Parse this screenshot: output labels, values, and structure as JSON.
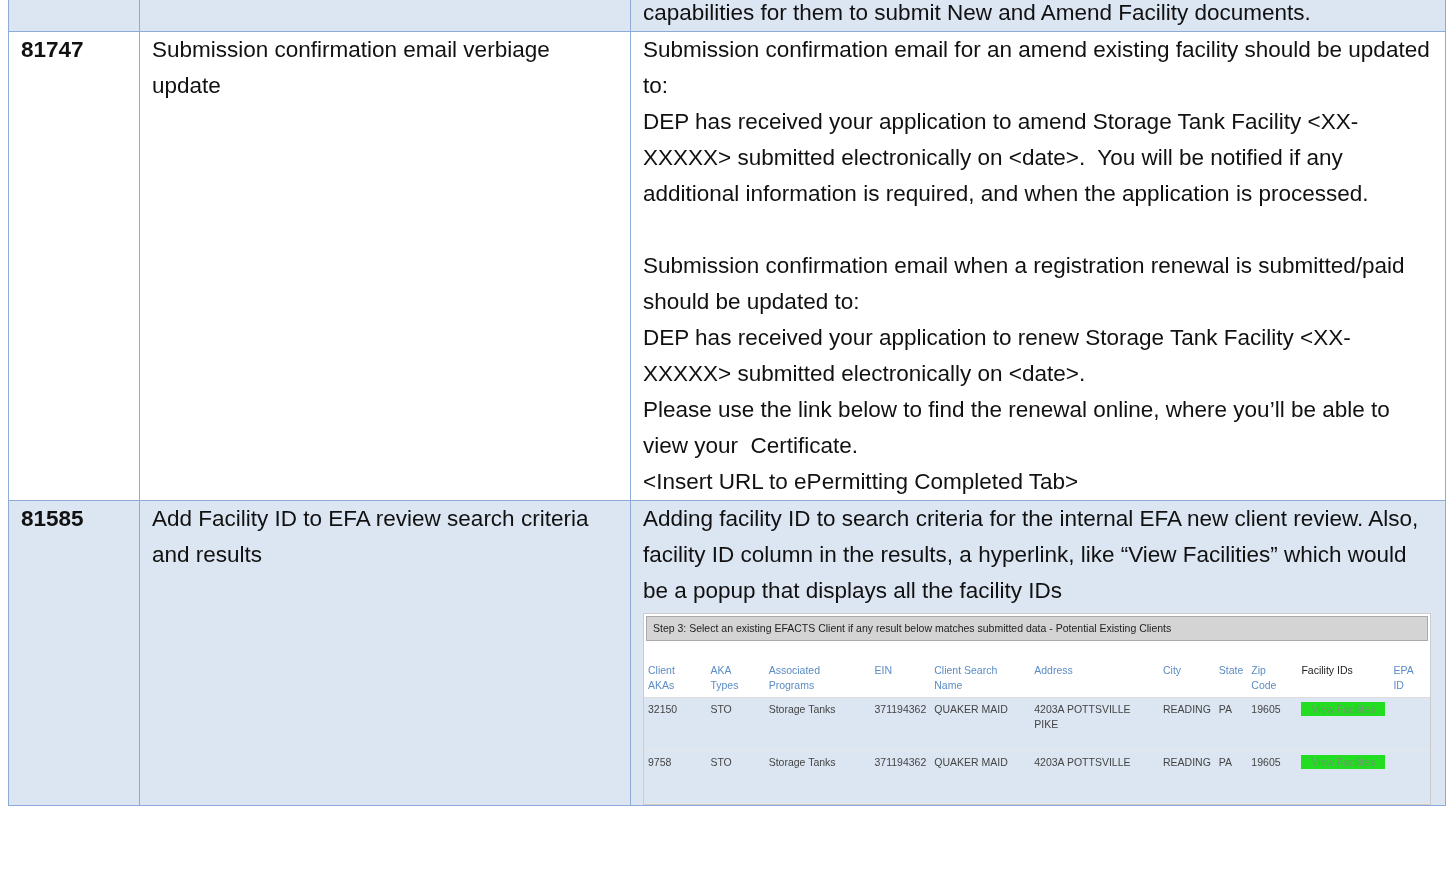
{
  "table": {
    "rows": [
      {
        "shaded": true,
        "details": [
          [
            "capabilities for them to submit New and Amend Facility documents."
          ]
        ]
      },
      {
        "shaded": false,
        "id": "81747",
        "title": "Submission confirmation email verbiage update",
        "details": [
          [
            "Submission confirmation email for an amend existing facility should be updated to:",
            "DEP has received your application to amend Storage Tank Facility <XX-XXXXX> submitted electronically on <date>.  You will be notified if any additional information is required, and when the application is processed."
          ],
          [
            "Submission confirmation email when a registration renewal is submitted/paid should be updated to:",
            "DEP has received your application to renew Storage Tank Facility <XX-XXXXX> submitted electronically on <date>.",
            "Please use the link below to find the renewal online, where you’ll be able to view your  Certificate.",
            "<Insert URL to ePermitting Completed Tab>"
          ]
        ]
      },
      {
        "shaded": true,
        "id": "81585",
        "title": "Add Facility ID to EFA review search criteria and results",
        "details": [
          [
            "Adding facility ID to search criteria for the internal EFA new client review. Also, facility ID column in the results, a hyperlink, like “View Facilities” which would be a popup that displays all the facility IDs"
          ]
        ],
        "screenshot": {
          "step": "Step 3: Select an existing EFACTS Client if any result below matches submitted data - Potential Existing Clients",
          "columns": [
            {
              "label": "Client AKAs",
              "sortable": true
            },
            {
              "label": "AKA Types",
              "sortable": true
            },
            {
              "label": "Associated Programs",
              "sortable": true
            },
            {
              "label": "EIN",
              "sortable": true
            },
            {
              "label": "Client Search Name",
              "sortable": true
            },
            {
              "label": "Address",
              "sortable": true
            },
            {
              "label": "City",
              "sortable": true
            },
            {
              "label": "State",
              "sortable": true
            },
            {
              "label": "Zip Code",
              "sortable": true
            },
            {
              "label": "Facility IDs",
              "sortable": false
            },
            {
              "label": "EPA ID",
              "sortable": true
            }
          ],
          "rows": [
            [
              {
                "kind": "text",
                "text": "32150"
              },
              {
                "kind": "text",
                "text": "STO"
              },
              {
                "kind": "text",
                "text": "Storage Tanks"
              },
              {
                "kind": "text",
                "text": "371194362"
              },
              {
                "kind": "text",
                "text": "QUAKER MAID"
              },
              {
                "kind": "text",
                "text": "4203A POTTSVILLE PIKE"
              },
              {
                "kind": "text",
                "text": "READING"
              },
              {
                "kind": "text",
                "text": "PA"
              },
              {
                "kind": "text",
                "text": "19605"
              },
              {
                "kind": "link",
                "text": "View Facilites"
              }
            ],
            [
              {
                "kind": "text",
                "text": "9758"
              },
              {
                "kind": "text",
                "text": "STO"
              },
              {
                "kind": "text",
                "text": "Storage Tanks"
              },
              {
                "kind": "text",
                "text": "371194362"
              },
              {
                "kind": "text",
                "text": "QUAKER MAID"
              },
              {
                "kind": "text",
                "text": "4203A POTTSVILLE"
              },
              {
                "kind": "text",
                "text": "READING"
              },
              {
                "kind": "text",
                "text": "PA"
              },
              {
                "kind": "text",
                "text": "19605"
              },
              {
                "kind": "link",
                "text": "View Facilites"
              }
            ]
          ]
        }
      }
    ]
  }
}
